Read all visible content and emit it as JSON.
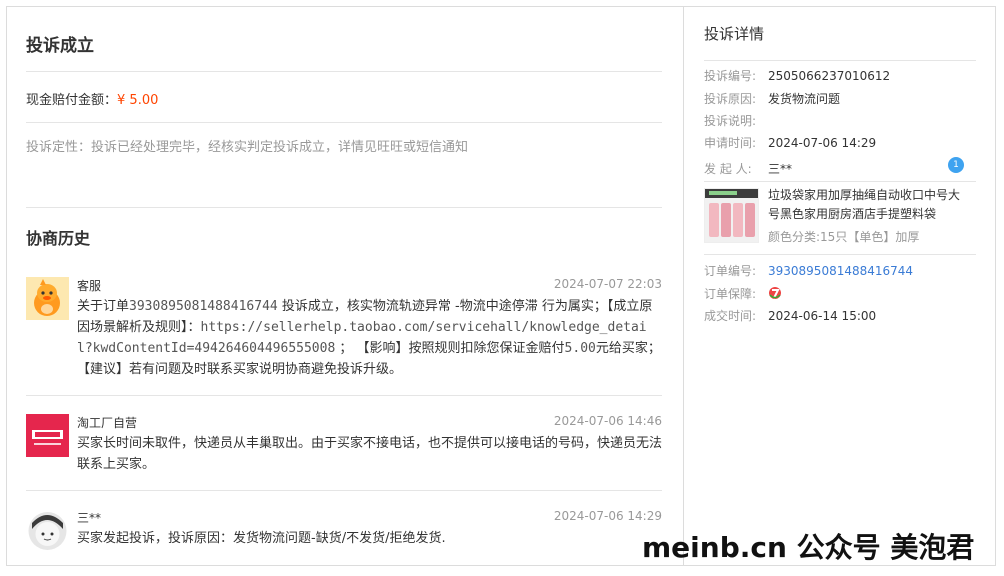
{
  "left": {
    "title": "投诉成立",
    "compensation_label": "现金赔付金额：",
    "compensation_amount": "¥ 5.00",
    "nature": "投诉定性：投诉已经处理完毕，经核实判定投诉成立，详情见旺旺或短信通知",
    "history_title": "协商历史",
    "messages": [
      {
        "sender": "客服",
        "time": "2024-07-07 22:03",
        "text_a": "关于订单",
        "order": "3930895081488416744",
        "text_b": " 投诉成立，核实物流轨迹异常 -物流中途停滞 行为属实；【成立原因场景解析及规则】：",
        "url": "https://sellerhelp.taobao.com/servicehall/knowledge_detail?kwdContentId=494264604496555008",
        "text_c": " ；  【影响】按照规则扣除您保证金赔付",
        "amount": "5.00",
        "text_d": "元给买家；  【建议】若有问题及时联系买家说明协商避免投诉升级。"
      },
      {
        "sender": "淘工厂自营",
        "time": "2024-07-06 14:46",
        "text": "买家长时间未取件，快递员从丰巢取出。由于买家不接电话，也不提供可以接电话的号码，快递员无法联系上买家。"
      },
      {
        "sender": "三**",
        "time": "2024-07-06 14:29",
        "text": "买家发起投诉，投诉原因：发货物流问题-缺货/不发货/拒绝发货."
      }
    ]
  },
  "right": {
    "title": "投诉详情",
    "complaint_no_label": "投诉编号:",
    "complaint_no": "2505066237010612",
    "reason_label": "投诉原因:",
    "reason": "发货物流问题",
    "desc_label": "投诉说明:",
    "apply_time_label": "申请时间:",
    "apply_time": "2024-07-06 14:29",
    "initiator_label": "发 起 人:",
    "initiator": "三**",
    "product_name": "垃圾袋家用加厚抽绳自动收口中号大号黑色家用厨房酒店手提塑料袋",
    "product_spec": "颜色分类:15只【单色】加厚",
    "order_no_label": "订单编号:",
    "order_no": "3930895081488416744",
    "guarantee_label": "订单保障:",
    "deal_time_label": "成交时间:",
    "deal_time": "2024-06-14 15:00"
  },
  "watermark": "meinb.cn 公众号 美泡君",
  "colors": {
    "price": "#ff4400",
    "link": "#3a7bd5",
    "muted": "#999999"
  }
}
